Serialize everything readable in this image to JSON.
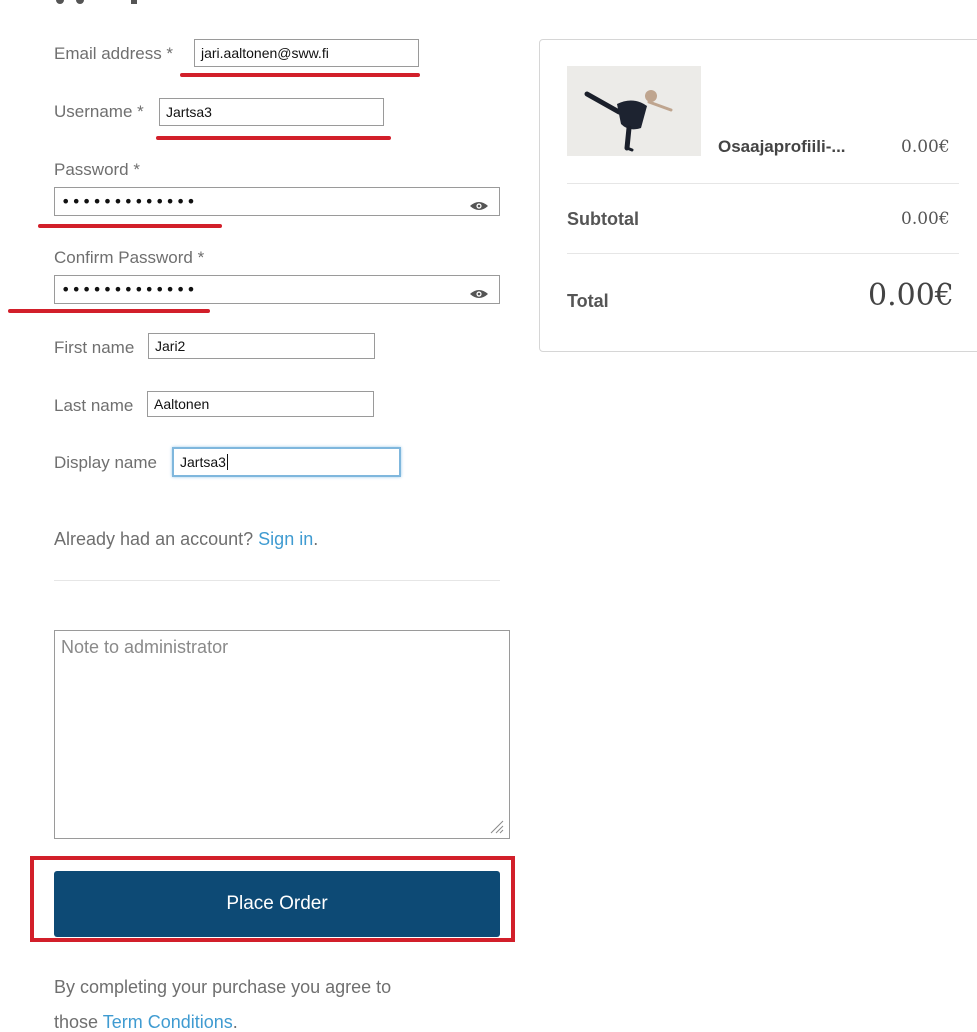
{
  "form": {
    "email": {
      "label": "Email address *",
      "value": "jari.aaltonen@sww.fi"
    },
    "username": {
      "label": "Username *",
      "value": "Jartsa3"
    },
    "password": {
      "label": "Password *",
      "value": "•••••••••••••"
    },
    "confirm_password": {
      "label": "Confirm Password *",
      "value": "•••••••••••••"
    },
    "first_name": {
      "label": "First name",
      "value": "Jari2"
    },
    "last_name": {
      "label": "Last name",
      "value": "Aaltonen"
    },
    "display_name": {
      "label": "Display name",
      "value": "Jartsa3"
    },
    "signin": {
      "prompt": "Already had an account?",
      "link": "Sign in",
      "period": "."
    },
    "note": {
      "placeholder": "Note to administrator"
    },
    "place_order_label": "Place Order",
    "terms": {
      "line1": "By completing your purchase you agree to",
      "line2_prefix": "those ",
      "link": "Term Conditions",
      "period": "."
    }
  },
  "order_summary": {
    "product_name": "Osaajaprofiili-...",
    "product_price": "0.00€",
    "subtotal_label": "Subtotal",
    "subtotal_value": "0.00€",
    "total_label": "Total",
    "total_value": "0.00€"
  },
  "annotation_color": "#d21f2a",
  "button_color": "#0d4a75",
  "link_color": "#3f9bd1"
}
